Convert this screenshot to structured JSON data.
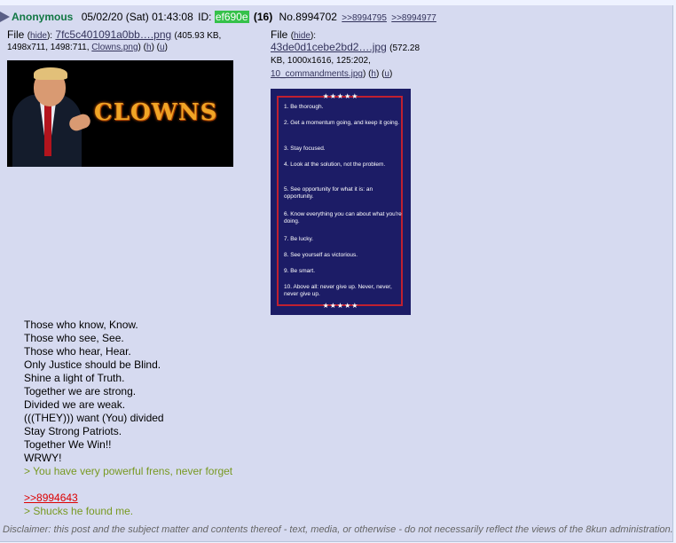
{
  "post": {
    "name": "Anonymous",
    "date": "05/02/20 (Sat) 01:43:08",
    "id_label": "ID:",
    "id": "ef690e",
    "count": "(16)",
    "number": "No.8994702",
    "backlinks": [
      ">>8994795",
      ">>8994977"
    ]
  },
  "files": [
    {
      "label": "File",
      "hide": "hide",
      "filename": "7fc5c401091a0bb….png",
      "meta_a": "(405.93 KB,",
      "meta_b": "1498x711, 1498:711,",
      "orig": "Clowns.png",
      "meta_c": ")",
      "h": "h",
      "u": "u",
      "image_text": "CLOWNS"
    },
    {
      "label": "File",
      "hide": "hide",
      "filename": "43de0d1cebe2bd2….jpg",
      "meta_a": "(572.28",
      "meta_b": "KB, 1000x1616, 125:202,",
      "orig": "10_commandments.jpg",
      "meta_c": ")",
      "h": "h",
      "u": "u",
      "image_stars": "★★★★★",
      "commandments": [
        "1. Be thorough.",
        "2. Get a momentum going, and keep it going.",
        "3. Stay focused.",
        "4. Look at the solution, not the problem.",
        "5. See opportunity for what it is: an opportunity.",
        "6. Know everything you can about what you're doing.",
        "7. Be lucky.",
        "8. See yourself as victorious.",
        "9. Be smart.",
        "10. Above all: never give up. Never, never, never give up."
      ]
    }
  ],
  "body": {
    "lines": [
      "Those who know, Know.",
      "Those who see, See.",
      "Those who hear, Hear.",
      "Only Justice should be Blind.",
      "Shine a light of Truth.",
      "Together we are strong.",
      "Divided we are weak.",
      "(((THEY))) want (You) divided",
      "Stay Strong Patriots.",
      "Together We Win!!",
      "WRWY!"
    ],
    "greentext1": "> You have very powerful frens, never forget",
    "reply_link": ">>8994643",
    "greentext2": "> Shucks he found me."
  },
  "disclaimer": "Disclaimer: this post and the subject matter and contents thereof - text, media, or otherwise - do not necessarily reflect the views of the 8kun administration."
}
